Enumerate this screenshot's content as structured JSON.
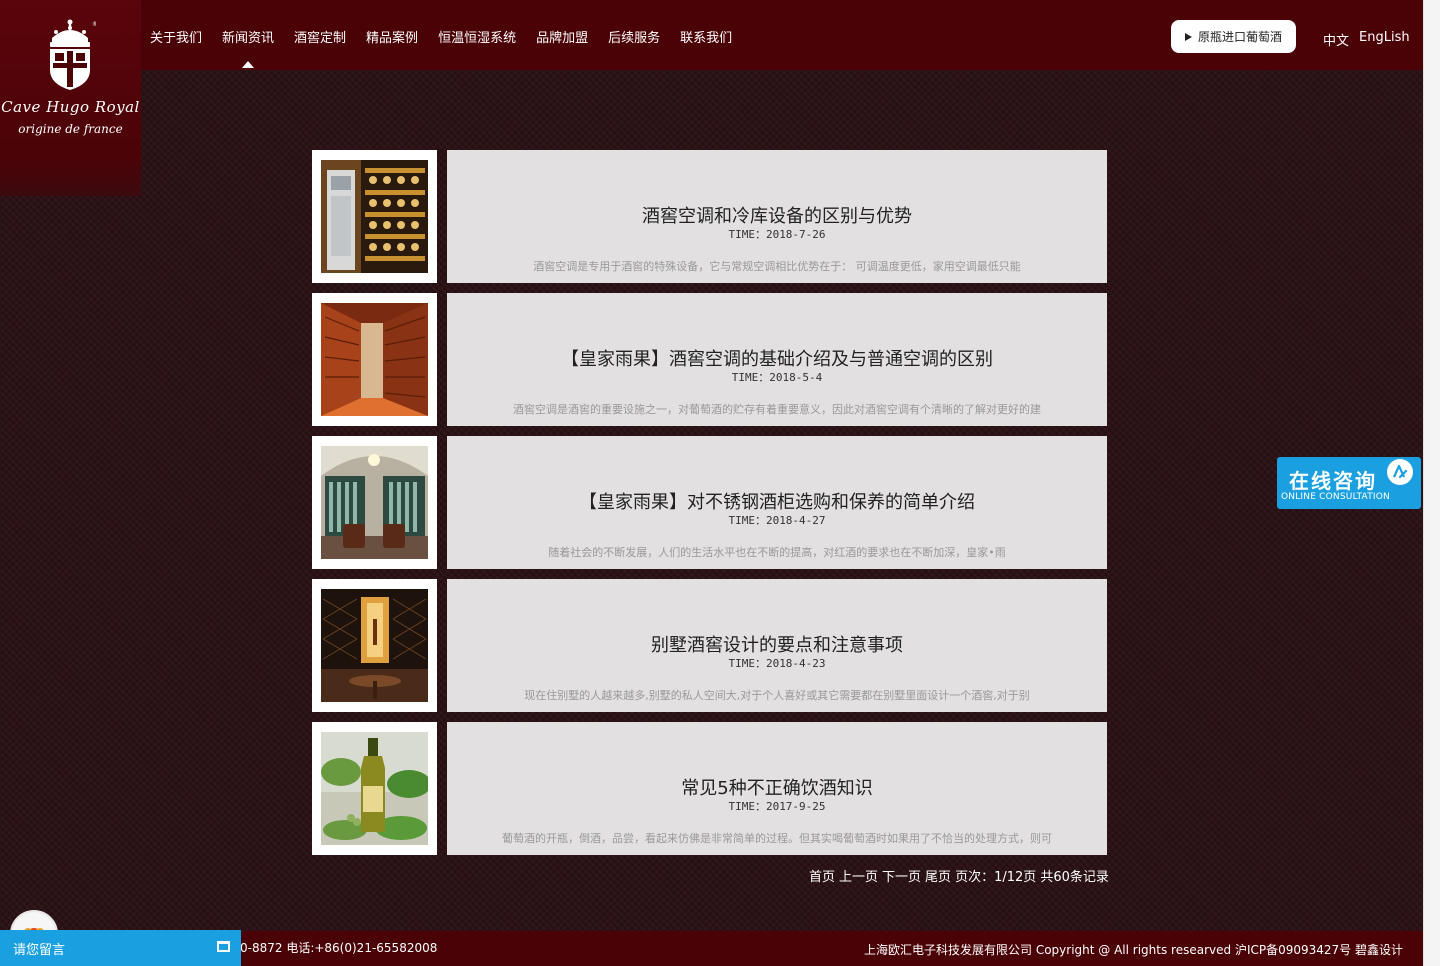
{
  "logo": {
    "line1": "Cave Hugo Royal",
    "line2": "origine de france"
  },
  "nav": {
    "items": [
      "关于我们",
      "新闻资讯",
      "酒窖定制",
      "精品案例",
      "恒温恒湿系统",
      "品牌加盟",
      "后续服务",
      "联系我们"
    ],
    "active_index": 1
  },
  "header": {
    "import_button": "原瓶进口葡萄酒",
    "lang_cn": "中文",
    "lang_en": "EngLish"
  },
  "news": [
    {
      "title": "酒窖空调和冷库设备的区别与优势",
      "time": "TIME：2018-7-26",
      "excerpt": "酒窖空调是专用于酒窖的特殊设备，它与常规空调相比优势在于：    可调温度更低，家用空调最低只能"
    },
    {
      "title": "【皇家雨果】酒窖空调的基础介绍及与普通空调的区别",
      "time": "TIME：2018-5-4",
      "excerpt": "酒窖空调是酒窖的重要设施之一，对葡萄酒的贮存有着重要意义，因此对酒窖空调有个清晰的了解对更好的建"
    },
    {
      "title": "【皇家雨果】对不锈钢酒柜选购和保养的简单介绍",
      "time": "TIME：2018-4-27",
      "excerpt": "随着社会的不断发展，人们的生活水平也在不断的提高，对红酒的要求也在不断加深，皇家•雨"
    },
    {
      "title": "别墅酒窖设计的要点和注意事项",
      "time": "TIME：2018-4-23",
      "excerpt": "现在住别墅的人越来越多,别墅的私人空间大,对于个人喜好或其它需要都在别墅里面设计一个酒窖,对于别"
    },
    {
      "title": "常见5种不正确饮酒知识",
      "time": "TIME：2017-9-25",
      "excerpt": "葡萄酒的开瓶，倒酒，品尝，看起来仿佛是非常简单的过程。但其实喝葡萄酒时如果用了不恰当的处理方式，则可"
    }
  ],
  "pagination": {
    "first": "首页",
    "prev": "上一页",
    "next": "下一页",
    "last": "尾页",
    "info": "页次：1/12页 共60条记录"
  },
  "consult": {
    "cn": "在线咨询",
    "en": "ONLINE CONSULTATION"
  },
  "footer": {
    "contact": "0-8872 电话:+86(0)21-65582008",
    "copyright": "上海欧汇电子科技发展有限公司 Copyright @ All rights researved 沪ICP备09093427号 碧鑫设计"
  },
  "message_bar": {
    "label": "请您留言"
  },
  "colors": {
    "header": "#4a0207",
    "background": "#2c1216",
    "card": "#e2e0e1",
    "accent": "#1aa0e0"
  }
}
